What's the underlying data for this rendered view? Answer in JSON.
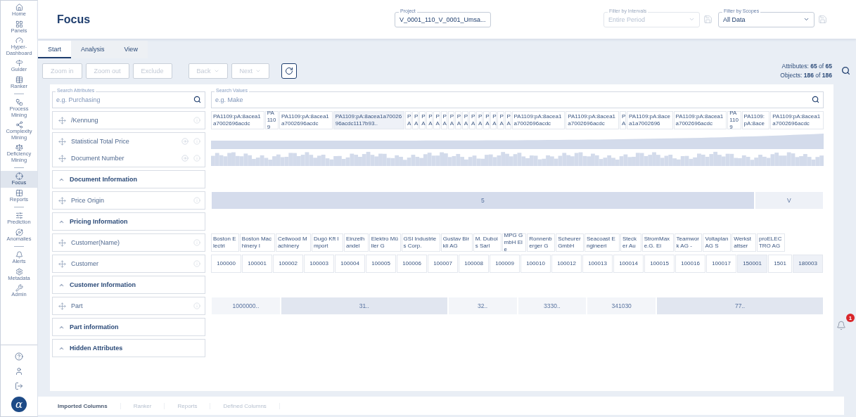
{
  "nav": {
    "items": [
      {
        "kind": "item",
        "label": "Home",
        "selected": false
      },
      {
        "kind": "item",
        "label": "Panels",
        "selected": false
      },
      {
        "kind": "item",
        "label": "Hyper-Dashboard",
        "selected": false
      },
      {
        "kind": "item",
        "label": "Guider",
        "selected": false
      },
      {
        "kind": "item",
        "label": "Ranker",
        "selected": false
      },
      {
        "kind": "divider"
      },
      {
        "kind": "item",
        "label": "Process Mining",
        "selected": false
      },
      {
        "kind": "item",
        "label": "Complexity Mining",
        "selected": false
      },
      {
        "kind": "item",
        "label": "Deficiency Mining",
        "selected": false
      },
      {
        "kind": "divider"
      },
      {
        "kind": "item",
        "label": "Focus",
        "selected": true
      },
      {
        "kind": "item",
        "label": "Reports",
        "selected": false
      },
      {
        "kind": "divider"
      },
      {
        "kind": "item",
        "label": "Prediction",
        "selected": false
      },
      {
        "kind": "item",
        "label": "Anomalies",
        "selected": false
      },
      {
        "kind": "divider"
      },
      {
        "kind": "item",
        "label": "Alerts",
        "selected": false
      },
      {
        "kind": "item",
        "label": "Metadata",
        "selected": false
      },
      {
        "kind": "item",
        "label": "Admin",
        "selected": false
      }
    ],
    "logo": "α"
  },
  "header": {
    "title": "Focus",
    "filters": [
      {
        "label": "Project",
        "value": "V_0001_110_V_0001_Umsa...",
        "disabled": false,
        "save": false
      },
      {
        "label": "Filter by Intervals",
        "value": "Entire Period",
        "disabled": true,
        "save": true
      },
      {
        "label": "Filter by Scopes",
        "value": "All Data",
        "disabled": false,
        "save": true
      }
    ]
  },
  "tabs": [
    {
      "label": "Start",
      "selected": true
    },
    {
      "label": "Analysis",
      "selected": false
    },
    {
      "label": "View",
      "selected": false
    }
  ],
  "toolbar": {
    "buttons": [
      {
        "label": "Zoom in",
        "disabled": true,
        "dropdown": false
      },
      {
        "label": "Zoom out",
        "disabled": true,
        "dropdown": false
      },
      {
        "label": "Exclude",
        "disabled": true,
        "dropdown": false
      },
      {
        "label": "Back",
        "disabled": true,
        "dropdown": true
      },
      {
        "label": "Next",
        "disabled": true,
        "dropdown": true
      }
    ],
    "stats": [
      "Attributes: **65** of **65**",
      "Objects: **186** of **186**"
    ]
  },
  "attribute_search": {
    "label": "Search Attributes",
    "placeholder": "e.g. Purchasing"
  },
  "value_search": {
    "label": "Search Values",
    "placeholder": "e.g. Make"
  },
  "cards": [
    {
      "items": [
        {
          "kind": "attribute",
          "label": "/Kennung",
          "linked": false,
          "values": {
            "kind": "cells",
            "wrap": true,
            "cells": [
              {
                "text": "PA1109:pA:8acea1a7002696acdc",
                "selected": false
              },
              {
                "text": "PA1109",
                "selected": false
              },
              {
                "text": "PA1109:pA:8acea1a7002696acdc",
                "selected": false
              },
              {
                "text": "PA1109:pA:8acea1a7002696acdc1117b93..",
                "selected": true
              },
              {
                "text": "PA",
                "selected": false
              },
              {
                "text": "PA",
                "selected": false
              },
              {
                "text": "PA",
                "selected": false
              },
              {
                "text": "PA",
                "selected": false
              },
              {
                "text": "PA",
                "selected": false
              },
              {
                "text": "PA",
                "selected": false
              },
              {
                "text": "PA",
                "selected": false
              },
              {
                "text": "PA",
                "selected": false
              },
              {
                "text": "PA",
                "selected": false
              },
              {
                "text": "PA",
                "selected": false
              },
              {
                "text": "PA",
                "selected": false
              },
              {
                "text": "PA",
                "selected": false
              },
              {
                "text": "PA",
                "selected": false
              },
              {
                "text": "PA",
                "selected": false
              },
              {
                "text": "PA",
                "selected": false
              },
              {
                "text": "PA1109:pA:8acea1a7002696acdc",
                "selected": false
              },
              {
                "text": "PA1109:pA:8acea1a7002696acdc",
                "selected": false
              },
              {
                "text": "PA",
                "selected": false
              },
              {
                "text": "PA1109:pA:8acea1a7002696",
                "selected": false
              },
              {
                "text": "PA1109:pA:8acea1a7002696acdc",
                "selected": false
              },
              {
                "text": "PA1109",
                "selected": false
              },
              {
                "text": "PA1109:pA:8ace",
                "selected": false
              },
              {
                "text": "PA1109:pA:8acea1a7002696acdc",
                "selected": false
              }
            ]
          }
        }
      ]
    },
    {
      "items": [
        {
          "kind": "attribute",
          "label": "Statistical Total Price",
          "linked": true,
          "values": {
            "kind": "area"
          }
        },
        {
          "kind": "attribute",
          "label": "Document Number",
          "linked": true,
          "values": {
            "kind": "histogram"
          }
        }
      ]
    },
    {
      "items": [
        {
          "kind": "group",
          "label": "Document Information"
        }
      ]
    },
    {
      "items": [
        {
          "kind": "attribute",
          "label": "Price Origin",
          "linked": false,
          "values": {
            "kind": "bars",
            "cells": [
              {
                "text": "5",
                "selected": true
              },
              {
                "text": "V",
                "selected": false
              }
            ]
          }
        }
      ]
    },
    {
      "items": [
        {
          "kind": "group",
          "label": "Pricing Information"
        }
      ]
    },
    {
      "items": [
        {
          "kind": "attribute",
          "label": "Customer(Name)",
          "linked": false,
          "values": {
            "kind": "cells",
            "wrap": true,
            "cells": [
              {
                "text": "Boston Electri",
                "selected": false
              },
              {
                "text": "Boston Machinery I",
                "selected": false
              },
              {
                "text": "Cellwood Machinery",
                "selected": false
              },
              {
                "text": "Dugó Kft Import",
                "selected": false
              },
              {
                "text": "Einzelhandel",
                "selected": false
              },
              {
                "text": "Elektro Müller G",
                "selected": false
              },
              {
                "text": "GSI Industries Corp.",
                "selected": false
              },
              {
                "text": "Gustav Birkli AG",
                "selected": false
              },
              {
                "text": "M. Dubois Sarl",
                "selected": false
              },
              {
                "text": "MPG GmbH Ele",
                "selected": false
              },
              {
                "text": "Ronnenberger G",
                "selected": false
              },
              {
                "text": "Scheurer GmbH",
                "selected": false
              },
              {
                "text": "Seacoast Engineeri",
                "selected": false
              },
              {
                "text": "Stecker Au",
                "selected": false
              },
              {
                "text": "StromMax e.G. Ei",
                "selected": false
              },
              {
                "text": "Teamwork AG -",
                "selected": false
              },
              {
                "text": "Voltaplan AG S",
                "selected": false
              },
              {
                "text": "Werkstattser",
                "selected": false
              },
              {
                "text": "proELECTRO AG",
                "selected": false
              }
            ]
          }
        }
      ]
    },
    {
      "items": [
        {
          "kind": "attribute",
          "label": "Customer",
          "linked": false,
          "values": {
            "kind": "cells",
            "wrap": false,
            "cells": [
              {
                "text": "100000",
                "selected": false
              },
              {
                "text": "100001",
                "selected": false
              },
              {
                "text": "100002",
                "selected": false
              },
              {
                "text": "100003",
                "selected": false
              },
              {
                "text": "100004",
                "selected": false
              },
              {
                "text": "100005",
                "selected": false
              },
              {
                "text": "100006",
                "selected": false
              },
              {
                "text": "100007",
                "selected": false
              },
              {
                "text": "100008",
                "selected": false
              },
              {
                "text": "100009",
                "selected": false
              },
              {
                "text": "100010",
                "selected": false
              },
              {
                "text": "100012",
                "selected": false
              },
              {
                "text": "100013",
                "selected": false
              },
              {
                "text": "100014",
                "selected": false
              },
              {
                "text": "100015",
                "selected": false
              },
              {
                "text": "100016",
                "selected": false
              },
              {
                "text": "100017",
                "selected": false
              },
              {
                "text": "150001",
                "selected": true
              },
              {
                "text": "1501",
                "selected": false
              },
              {
                "text": "180003",
                "selected": true
              }
            ]
          }
        }
      ]
    },
    {
      "items": [
        {
          "kind": "group",
          "label": "Customer Information"
        }
      ]
    },
    {
      "items": [
        {
          "kind": "attribute",
          "label": "Part",
          "linked": false,
          "values": {
            "kind": "bars",
            "cells": [
              {
                "text": "1000000..",
                "selected": false
              },
              {
                "text": "31..",
                "selected": true
              },
              {
                "text": "32..",
                "selected": false
              },
              {
                "text": "3330..",
                "selected": false
              },
              {
                "text": "341030",
                "selected": false
              },
              {
                "text": "77..",
                "selected": true
              }
            ]
          }
        }
      ]
    },
    {
      "items": [
        {
          "kind": "group",
          "label": "Part information"
        }
      ]
    },
    {
      "items": [
        {
          "kind": "group",
          "label": "Hidden Attributes"
        }
      ]
    }
  ],
  "notification": {
    "count": "1"
  },
  "bottom_tabs": [
    {
      "label": "Imported Columns",
      "selected": true
    },
    {
      "label": "Ranker",
      "selected": false
    },
    {
      "label": "Reports",
      "selected": false
    },
    {
      "label": "Defined Columns",
      "selected": false
    }
  ]
}
